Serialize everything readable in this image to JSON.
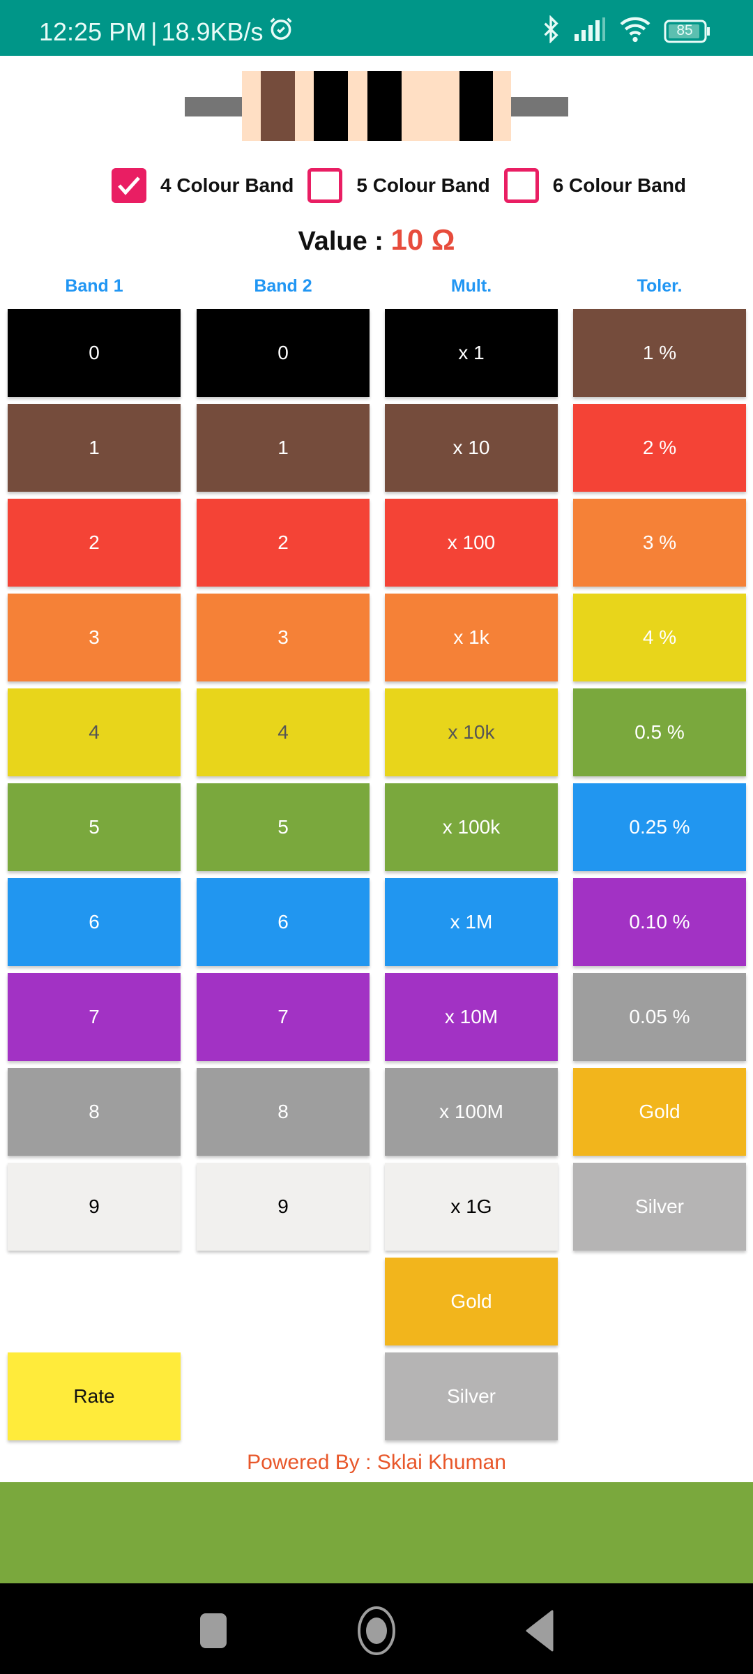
{
  "status_bar": {
    "time": "12:25 PM",
    "separator": "|",
    "net_speed": "18.9KB/s",
    "battery": "85",
    "icons": [
      "alarm-icon",
      "bluetooth-icon",
      "signal-icon",
      "wifi-icon",
      "battery-icon"
    ]
  },
  "resistor": {
    "body_color": "#ffdfc4",
    "lead_color": "#757575",
    "bands": [
      {
        "name": "band1",
        "color": "#754c3c"
      },
      {
        "name": "band2",
        "color": "#000000"
      },
      {
        "name": "multiplier",
        "color": "#000000"
      },
      {
        "name": "tolerance",
        "color": "#000000"
      }
    ]
  },
  "band_options": [
    {
      "label": "4 Colour Band",
      "checked": true
    },
    {
      "label": "5 Colour Band",
      "checked": false
    },
    {
      "label": "6 Colour Band",
      "checked": false
    }
  ],
  "value": {
    "label": "Value :",
    "result": "10 Ω"
  },
  "columns": [
    {
      "header": "Band 1",
      "cells": [
        {
          "label": "0",
          "bg": "#000000",
          "fg": "#ffffff"
        },
        {
          "label": "1",
          "bg": "#754c3c",
          "fg": "#ffffff"
        },
        {
          "label": "2",
          "bg": "#f44336",
          "fg": "#ffffff"
        },
        {
          "label": "3",
          "bg": "#f58137",
          "fg": "#ffffff"
        },
        {
          "label": "4",
          "bg": "#e8d51b",
          "fg": "#555555"
        },
        {
          "label": "5",
          "bg": "#7aa83d",
          "fg": "#ffffff"
        },
        {
          "label": "6",
          "bg": "#2196f0",
          "fg": "#ffffff"
        },
        {
          "label": "7",
          "bg": "#a232c4",
          "fg": "#ffffff"
        },
        {
          "label": "8",
          "bg": "#9e9e9e",
          "fg": "#ffffff"
        },
        {
          "label": "9",
          "bg": "#f1f0ee",
          "fg": "#000000"
        }
      ]
    },
    {
      "header": "Band 2",
      "cells": [
        {
          "label": "0",
          "bg": "#000000",
          "fg": "#ffffff"
        },
        {
          "label": "1",
          "bg": "#754c3c",
          "fg": "#ffffff"
        },
        {
          "label": "2",
          "bg": "#f44336",
          "fg": "#ffffff"
        },
        {
          "label": "3",
          "bg": "#f58137",
          "fg": "#ffffff"
        },
        {
          "label": "4",
          "bg": "#e8d51b",
          "fg": "#555555"
        },
        {
          "label": "5",
          "bg": "#7aa83d",
          "fg": "#ffffff"
        },
        {
          "label": "6",
          "bg": "#2196f0",
          "fg": "#ffffff"
        },
        {
          "label": "7",
          "bg": "#a232c4",
          "fg": "#ffffff"
        },
        {
          "label": "8",
          "bg": "#9e9e9e",
          "fg": "#ffffff"
        },
        {
          "label": "9",
          "bg": "#f1f0ee",
          "fg": "#000000"
        }
      ]
    },
    {
      "header": "Mult.",
      "cells": [
        {
          "label": "x 1",
          "bg": "#000000",
          "fg": "#ffffff"
        },
        {
          "label": "x 10",
          "bg": "#754c3c",
          "fg": "#ffffff"
        },
        {
          "label": "x 100",
          "bg": "#f44336",
          "fg": "#ffffff"
        },
        {
          "label": "x 1k",
          "bg": "#f58137",
          "fg": "#ffffff"
        },
        {
          "label": "x 10k",
          "bg": "#e8d51b",
          "fg": "#555555"
        },
        {
          "label": "x 100k",
          "bg": "#7aa83d",
          "fg": "#ffffff"
        },
        {
          "label": "x 1M",
          "bg": "#2196f0",
          "fg": "#ffffff"
        },
        {
          "label": "x 10M",
          "bg": "#a232c4",
          "fg": "#ffffff"
        },
        {
          "label": "x 100M",
          "bg": "#9e9e9e",
          "fg": "#ffffff"
        },
        {
          "label": "x 1G",
          "bg": "#f1f0ee",
          "fg": "#000000"
        },
        {
          "label": "Gold",
          "bg": "#f2b51c",
          "fg": "#ffffff"
        },
        {
          "label": "Silver",
          "bg": "#b5b4b4",
          "fg": "#ffffff"
        }
      ]
    },
    {
      "header": "Toler.",
      "cells": [
        {
          "label": "1 %",
          "bg": "#754c3c",
          "fg": "#ffffff"
        },
        {
          "label": "2 %",
          "bg": "#f44336",
          "fg": "#ffffff"
        },
        {
          "label": "3 %",
          "bg": "#f58137",
          "fg": "#ffffff"
        },
        {
          "label": "4 %",
          "bg": "#e8d51b",
          "fg": "#ffffff"
        },
        {
          "label": "0.5 %",
          "bg": "#7aa83d",
          "fg": "#ffffff"
        },
        {
          "label": "0.25 %",
          "bg": "#2196f0",
          "fg": "#ffffff"
        },
        {
          "label": "0.10 %",
          "bg": "#a232c4",
          "fg": "#ffffff"
        },
        {
          "label": "0.05 %",
          "bg": "#9e9e9e",
          "fg": "#ffffff"
        },
        {
          "label": "Gold",
          "bg": "#f2b51c",
          "fg": "#ffffff"
        },
        {
          "label": "Silver",
          "bg": "#b5b4b4",
          "fg": "#ffffff"
        }
      ]
    }
  ],
  "rate_button": {
    "label": "Rate",
    "bg": "#ffeb3b",
    "fg": "#111111"
  },
  "footer": {
    "credit": "Powered By : Sklai Khuman"
  },
  "ad_banner": {
    "color": "#7aa83d"
  },
  "nav_bar": {
    "buttons": [
      "recents",
      "home",
      "back"
    ]
  }
}
